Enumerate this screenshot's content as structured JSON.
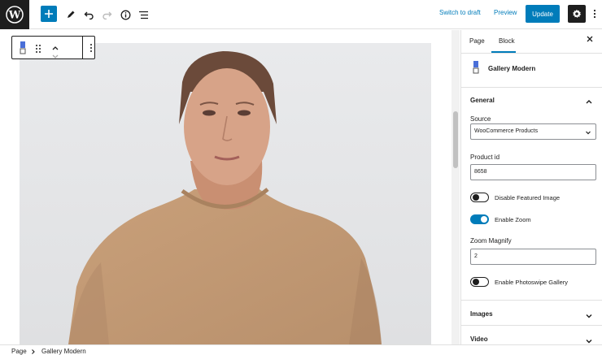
{
  "topbar": {
    "switch_to_draft": "Switch to draft",
    "preview": "Preview",
    "update": "Update"
  },
  "icons": {
    "logo": "wordpress-logo-icon",
    "add": "plus-icon",
    "tools": "pencil-icon",
    "undo": "undo-icon",
    "redo": "redo-icon",
    "info": "info-icon",
    "outline": "list-view-icon",
    "settings": "gear-icon",
    "more": "vertical-ellipsis-icon"
  },
  "sidebar": {
    "tabs": [
      {
        "label": "Page"
      },
      {
        "label": "Block"
      }
    ],
    "block_name": "Gallery Modern",
    "general": {
      "title": "General",
      "source_label": "Source",
      "source_value": "WooCommerce Products",
      "product_id_label": "Product id",
      "product_id_value": "8658",
      "disable_featured_label": "Disable Featured Image",
      "disable_featured_on": false,
      "enable_zoom_label": "Enable Zoom",
      "enable_zoom_on": true,
      "zoom_magnify_label": "Zoom Magnify",
      "zoom_magnify_value": "2",
      "photoswipe_label": "Enable Photoswipe Gallery",
      "photoswipe_on": false
    },
    "panels": [
      {
        "title": "Images"
      },
      {
        "title": "Video"
      }
    ]
  },
  "breadcrumb": {
    "root": "Page",
    "current": "Gallery Modern"
  },
  "colors": {
    "accent": "#007cba",
    "dark": "#1e1e1e",
    "sweater": "#c49a74",
    "background": "#eaeaea"
  }
}
